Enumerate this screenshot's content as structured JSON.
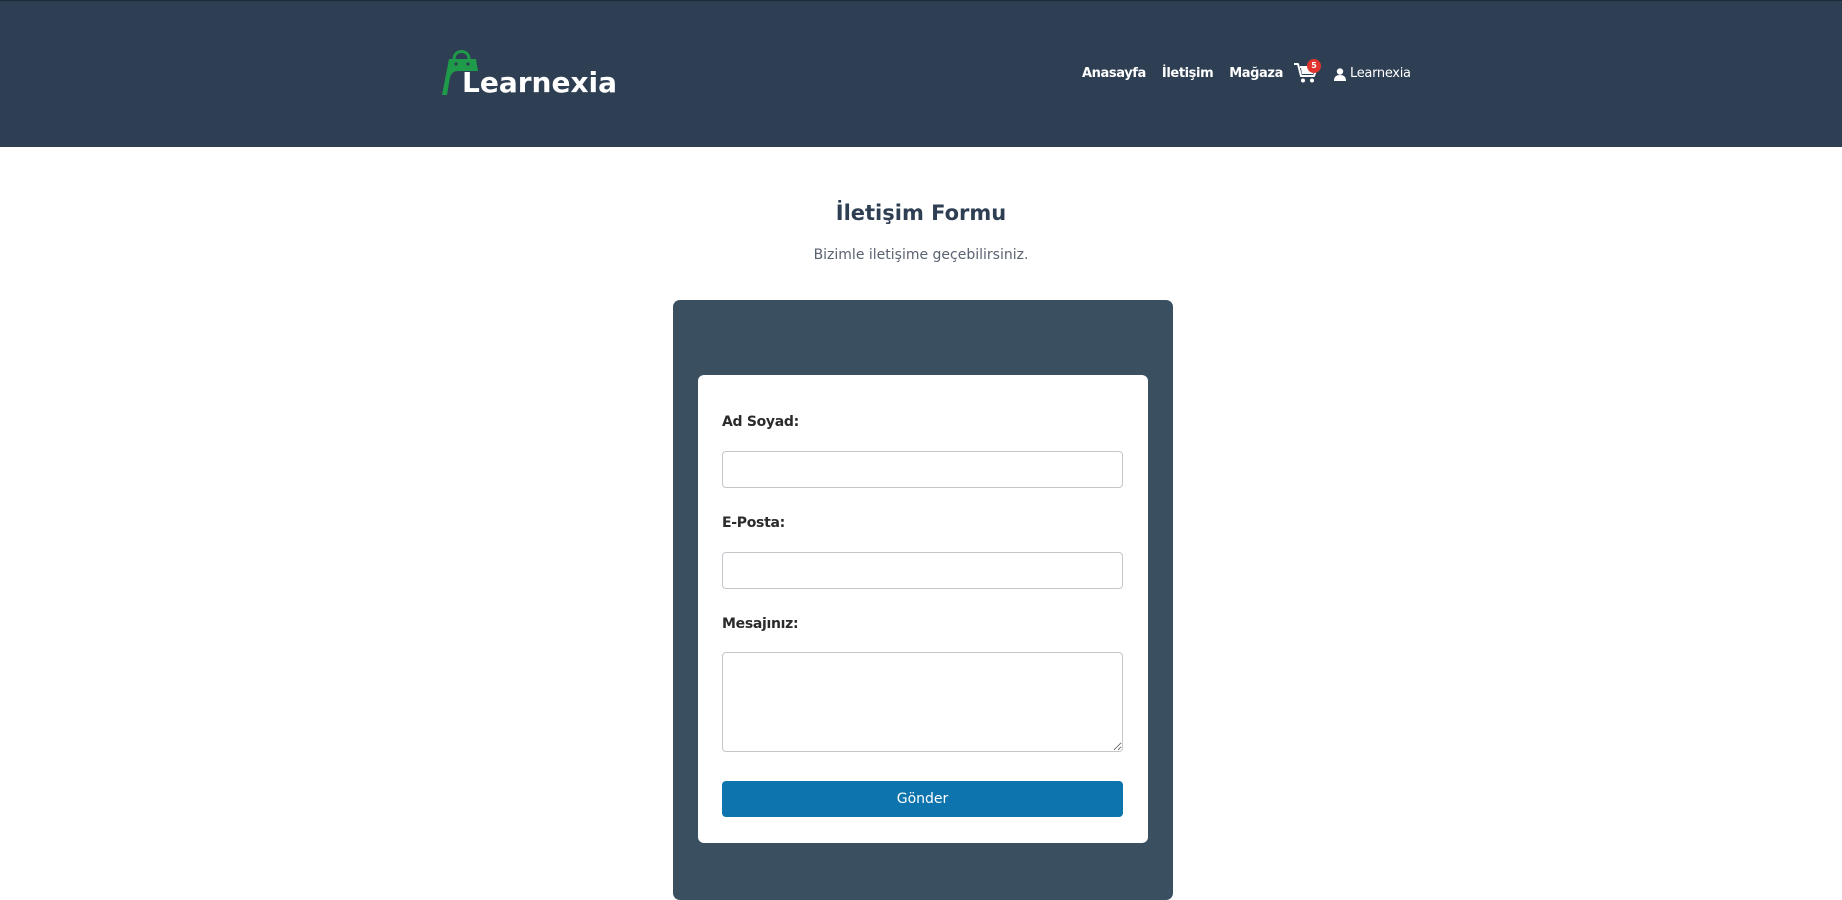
{
  "brand": {
    "name": "Learnexia",
    "accent_color": "#1e9a4a",
    "logo_icon": "shopping-bag-icon"
  },
  "header": {
    "background": "#2e3e53",
    "nav": [
      "Anasayfa",
      "İletişim",
      "Mağaza"
    ],
    "cart": {
      "icon": "cart-icon",
      "count": "5"
    },
    "user": {
      "icon": "user-icon",
      "label": "Learnexia"
    }
  },
  "page": {
    "title": "İletişim Formu",
    "subtitle": "Bizimle iletişime geçebilirsiniz."
  },
  "form": {
    "name_label": "Ad Soyad:",
    "name_value": "",
    "email_label": "E-Posta:",
    "email_value": "",
    "message_label": "Mesajınız:",
    "message_value": "",
    "submit_label": "Gönder",
    "submit_color": "#0e74ad",
    "panel_color": "#3a5061"
  }
}
